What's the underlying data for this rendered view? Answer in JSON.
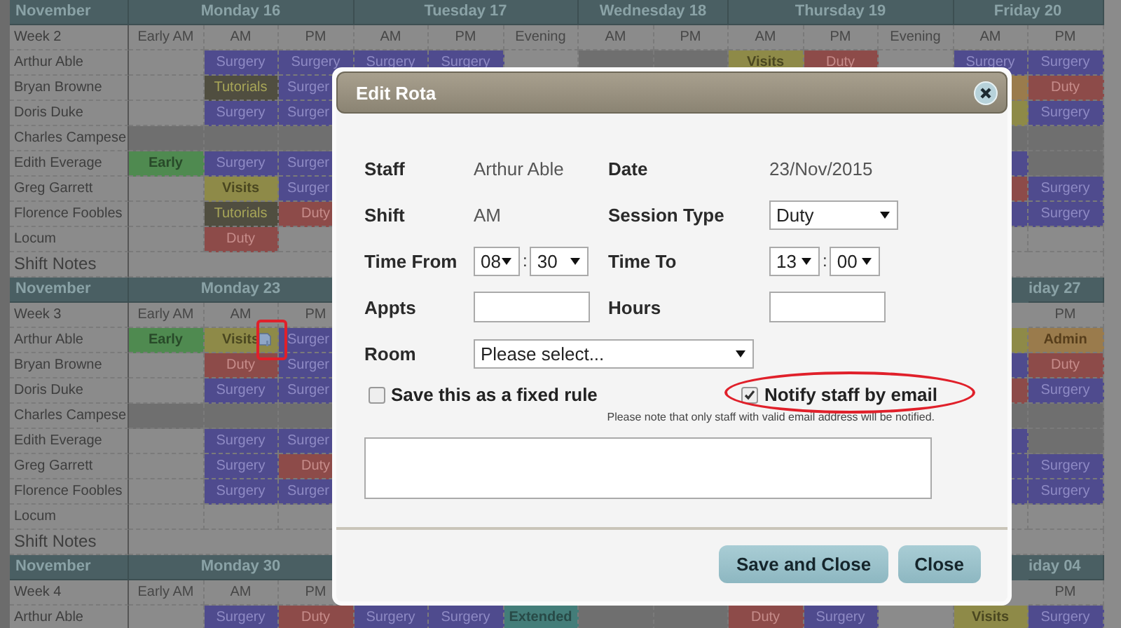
{
  "rota": [
    {
      "month": "November",
      "week": "Week 2",
      "notes_label": "Shift Notes",
      "days": [
        {
          "name": "Monday 16",
          "slots": [
            "Early AM",
            "AM",
            "PM"
          ]
        },
        {
          "name": "Tuesday 17",
          "slots": [
            "AM",
            "PM",
            "Evening"
          ]
        },
        {
          "name": "Wednesday 18",
          "slots": [
            "AM",
            "PM"
          ]
        },
        {
          "name": "Thursday 19",
          "slots": [
            "AM",
            "PM",
            "Evening"
          ]
        },
        {
          "name": "Friday 20",
          "slots": [
            "AM",
            "PM"
          ]
        }
      ],
      "rows": [
        {
          "name": "Arthur Able",
          "cells": [
            {
              "kind": "blank"
            },
            {
              "kind": "surgery",
              "text": "Surgery"
            },
            {
              "kind": "surgery",
              "text": "Surgery"
            },
            {
              "kind": "surgery",
              "text": "Surgery"
            },
            {
              "kind": "surgery",
              "text": "Surgery"
            },
            {
              "kind": "blank"
            },
            {
              "kind": "off"
            },
            {
              "kind": "off"
            },
            {
              "kind": "visits",
              "text": "Visits"
            },
            {
              "kind": "duty",
              "text": "Duty"
            },
            {
              "kind": "blank"
            },
            {
              "kind": "surgery",
              "text": "Surgery"
            },
            {
              "kind": "surgery",
              "text": "Surgery"
            }
          ]
        },
        {
          "name": "Bryan Browne",
          "cells": [
            {
              "kind": "blank"
            },
            {
              "kind": "tutorials",
              "text": "Tutorials"
            },
            {
              "kind": "surgery",
              "text": "Surger",
              "cut": true
            }
          ],
          "end_cells": [
            {
              "kind": "admin"
            },
            {
              "kind": "duty",
              "text": "Duty"
            }
          ]
        },
        {
          "name": "Doris Duke",
          "cells": [
            {
              "kind": "blank"
            },
            {
              "kind": "surgery",
              "text": "Surgery"
            },
            {
              "kind": "surgery",
              "text": "Surger",
              "cut": true
            }
          ],
          "end_cells": [
            {
              "kind": "visits"
            },
            {
              "kind": "surgery",
              "text": "Surgery"
            }
          ]
        },
        {
          "name": "Charles Campese",
          "cells": [
            {
              "kind": "off"
            },
            {
              "kind": "off"
            },
            {
              "kind": "off"
            }
          ],
          "end_cells": [
            {
              "kind": "off"
            },
            {
              "kind": "off"
            }
          ]
        },
        {
          "name": "Edith Everage",
          "cells": [
            {
              "kind": "early",
              "text": "Early"
            },
            {
              "kind": "surgery",
              "text": "Surgery"
            },
            {
              "kind": "surgery",
              "text": "Surger",
              "cut": true
            }
          ],
          "end_cells": [
            {
              "kind": "surgery"
            },
            {
              "kind": "off"
            }
          ]
        },
        {
          "name": "Greg Garrett",
          "cells": [
            {
              "kind": "blank"
            },
            {
              "kind": "visits",
              "text": "Visits"
            },
            {
              "kind": "surgery",
              "text": "Surger",
              "cut": true
            }
          ],
          "end_cells": [
            {
              "kind": "duty"
            },
            {
              "kind": "surgery",
              "text": "Surgery"
            }
          ]
        },
        {
          "name": "Florence Foobles",
          "cells": [
            {
              "kind": "blank"
            },
            {
              "kind": "tutorials",
              "text": "Tutorials"
            },
            {
              "kind": "duty",
              "text": "Duty"
            }
          ],
          "end_cells": [
            {
              "kind": "surgery"
            },
            {
              "kind": "surgery",
              "text": "Surgery"
            }
          ]
        },
        {
          "name": "Locum",
          "cells": [
            {
              "kind": "blank"
            },
            {
              "kind": "duty",
              "text": "Duty"
            },
            {
              "kind": "blank"
            }
          ],
          "end_cells": [
            {
              "kind": "blank"
            },
            {
              "kind": "blank"
            }
          ]
        }
      ]
    },
    {
      "month": "November",
      "week": "Week 3",
      "notes_label": "Shift Notes",
      "days": [
        {
          "name": "Monday 23",
          "slots": [
            "Early AM",
            "AM",
            "PM"
          ]
        }
      ],
      "end_days": [
        {
          "name": "iday 27",
          "cut": true,
          "slots": [
            "PM"
          ]
        }
      ],
      "rows": [
        {
          "name": "Arthur Able",
          "cells": [
            {
              "kind": "early",
              "text": "Early"
            },
            {
              "kind": "visits",
              "text": "Visits",
              "flagged": true,
              "highlighted": true
            },
            {
              "kind": "surgery",
              "text": "Surger",
              "cut": true
            }
          ],
          "end_cells": [
            {
              "kind": "visits"
            },
            {
              "kind": "admin",
              "text": "Admin"
            }
          ]
        },
        {
          "name": "Bryan Browne",
          "cells": [
            {
              "kind": "blank"
            },
            {
              "kind": "duty",
              "text": "Duty"
            },
            {
              "kind": "surgery",
              "text": "Surger",
              "cut": true
            }
          ],
          "end_cells": [
            {
              "kind": "surgery"
            },
            {
              "kind": "duty",
              "text": "Duty"
            }
          ]
        },
        {
          "name": "Doris Duke",
          "cells": [
            {
              "kind": "blank"
            },
            {
              "kind": "surgery",
              "text": "Surgery"
            },
            {
              "kind": "surgery",
              "text": "Surger",
              "cut": true
            }
          ],
          "end_cells": [
            {
              "kind": "duty"
            },
            {
              "kind": "surgery",
              "text": "Surgery"
            }
          ]
        },
        {
          "name": "Charles Campese",
          "cells": [
            {
              "kind": "off"
            },
            {
              "kind": "off"
            },
            {
              "kind": "off"
            }
          ],
          "end_cells": [
            {
              "kind": "off"
            },
            {
              "kind": "off"
            }
          ]
        },
        {
          "name": "Edith Everage",
          "cells": [
            {
              "kind": "blank"
            },
            {
              "kind": "surgery",
              "text": "Surgery"
            },
            {
              "kind": "surgery",
              "text": "Surger",
              "cut": true
            }
          ],
          "end_cells": [
            {
              "kind": "surgery"
            },
            {
              "kind": "off"
            }
          ]
        },
        {
          "name": "Greg Garrett",
          "cells": [
            {
              "kind": "blank"
            },
            {
              "kind": "surgery",
              "text": "Surgery"
            },
            {
              "kind": "duty",
              "text": "Duty"
            }
          ],
          "end_cells": [
            {
              "kind": "surgery"
            },
            {
              "kind": "surgery",
              "text": "Surgery"
            }
          ]
        },
        {
          "name": "Florence Foobles",
          "cells": [
            {
              "kind": "blank"
            },
            {
              "kind": "surgery",
              "text": "Surgery"
            },
            {
              "kind": "surgery",
              "text": "Surger",
              "cut": true
            }
          ],
          "end_cells": [
            {
              "kind": "surgery"
            },
            {
              "kind": "surgery",
              "text": "Surgery"
            }
          ]
        },
        {
          "name": "Locum",
          "cells": [
            {
              "kind": "blank"
            },
            {
              "kind": "blank"
            },
            {
              "kind": "blank"
            }
          ],
          "end_cells": [
            {
              "kind": "blank"
            },
            {
              "kind": "blank"
            }
          ]
        }
      ]
    },
    {
      "month": "November",
      "week": "Week 4",
      "days": [
        {
          "name": "Monday 30",
          "slots": [
            "Early AM",
            "AM",
            "PM"
          ]
        }
      ],
      "end_days": [
        {
          "name": "iday 04",
          "cut": true,
          "slots": [
            "PM"
          ]
        }
      ],
      "rows": [
        {
          "name": "Arthur Able",
          "cells": [
            {
              "kind": "blank"
            },
            {
              "kind": "surgery",
              "text": "Surgery"
            },
            {
              "kind": "duty",
              "text": "Duty"
            },
            {
              "kind": "surgery",
              "text": "Surgery"
            },
            {
              "kind": "surgery",
              "text": "Surgery"
            },
            {
              "kind": "extended",
              "text": "Extended"
            },
            {
              "kind": "off"
            },
            {
              "kind": "off"
            },
            {
              "kind": "duty",
              "text": "Duty"
            },
            {
              "kind": "surgery",
              "text": "Surgery"
            },
            {
              "kind": "blank"
            },
            {
              "kind": "visits",
              "text": "Visits"
            },
            {
              "kind": "surgery",
              "text": "Surgery"
            }
          ]
        }
      ]
    }
  ],
  "dialog": {
    "title": "Edit Rota",
    "staff": {
      "label": "Staff",
      "value": "Arthur Able"
    },
    "date": {
      "label": "Date",
      "value": "23/Nov/2015"
    },
    "shift": {
      "label": "Shift",
      "value": "AM"
    },
    "session_type": {
      "label": "Session Type",
      "value": "Duty"
    },
    "time_from": {
      "label": "Time From",
      "hour": "08",
      "separator": ":",
      "minute": "30"
    },
    "time_to": {
      "label": "Time To",
      "hour": "13",
      "separator": ":",
      "minute": "00"
    },
    "appts": {
      "label": "Appts"
    },
    "hours": {
      "label": "Hours"
    },
    "room": {
      "label": "Room",
      "value": "Please select..."
    },
    "fixed_rule": {
      "label": "Save this as a fixed rule",
      "checked": false
    },
    "notify": {
      "label": "Notify staff by email",
      "checked": true,
      "highlighted": true
    },
    "note": "Please note that only staff with valid email address will be notified.",
    "buttons": [
      "Save and Close",
      "Close"
    ]
  }
}
